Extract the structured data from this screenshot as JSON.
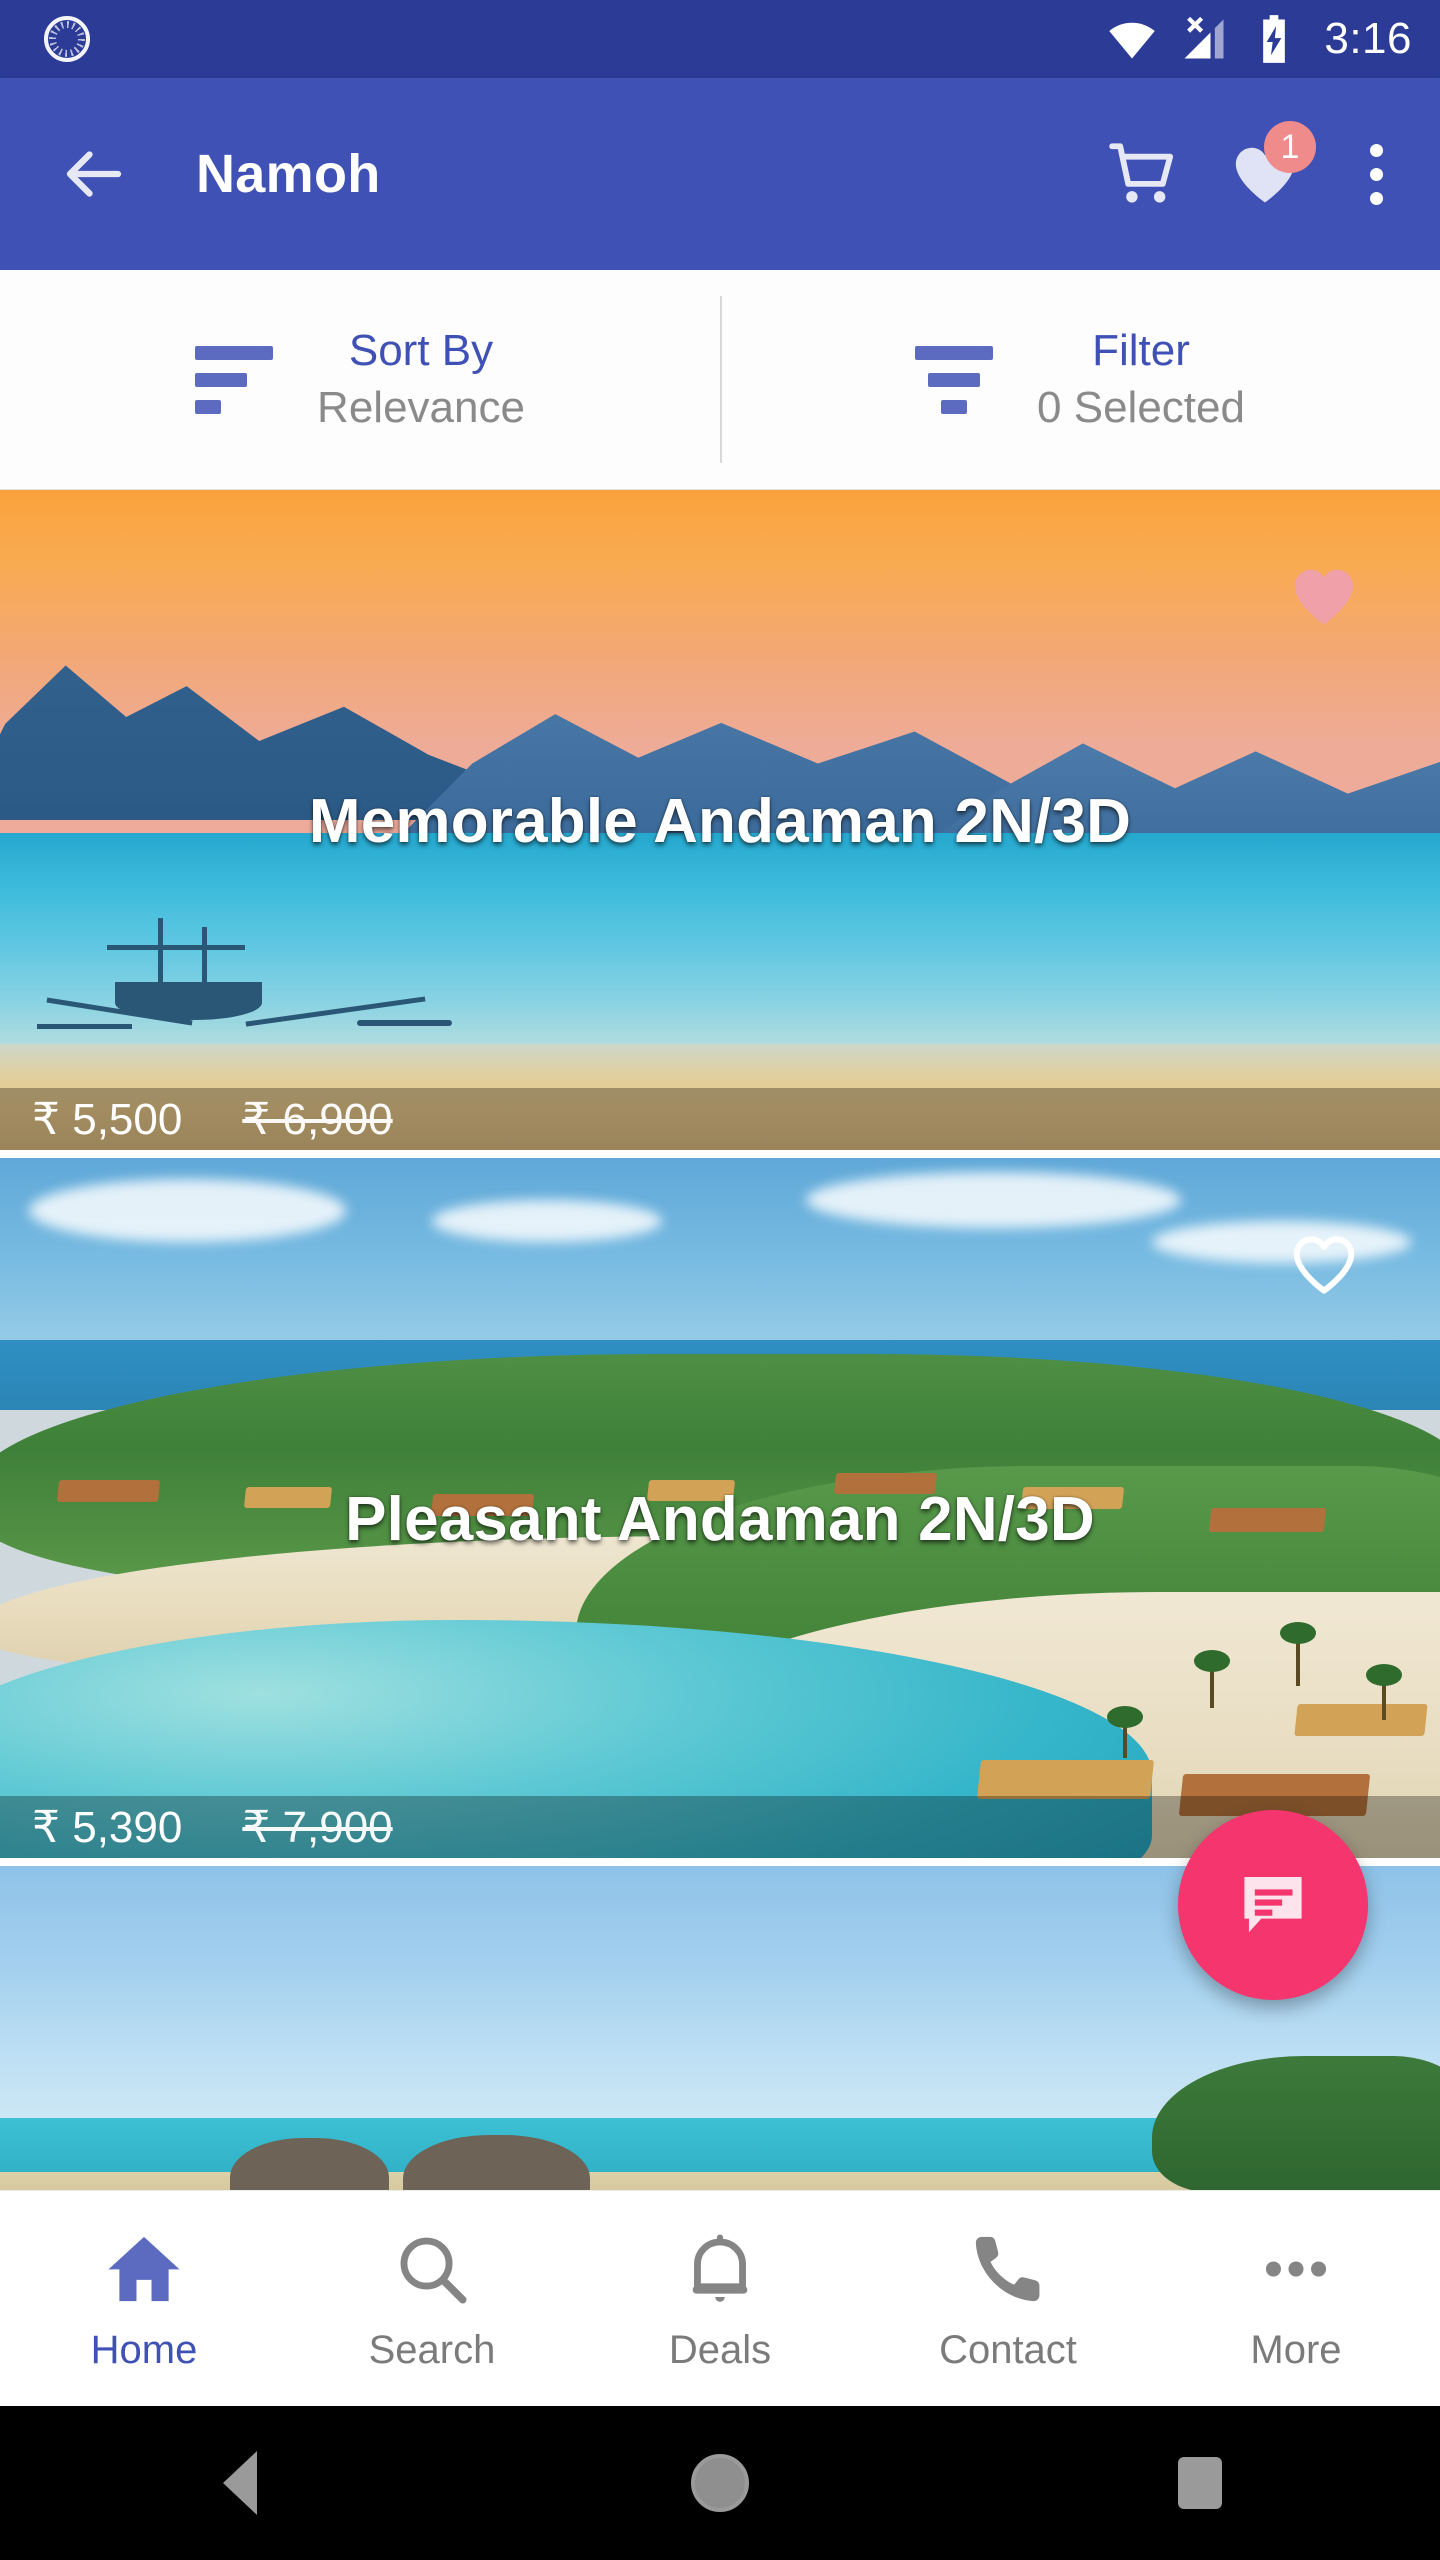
{
  "status_bar": {
    "sync_icon": "sync-progress-icon",
    "wifi_icon": "wifi-icon",
    "signal_icon": "cellular-no-sim-icon",
    "battery_icon": "battery-charging-icon",
    "time": "3:16"
  },
  "app_bar": {
    "back_icon": "back-arrow-icon",
    "title": "Namoh",
    "cart_icon": "shopping-cart-icon",
    "wishlist_icon": "heart-filled-icon",
    "wishlist_badge": "1",
    "overflow_icon": "more-vertical-icon",
    "background": "#3f51b5"
  },
  "sort_filter": {
    "sort": {
      "icon": "sort-bars-icon",
      "title": "Sort By",
      "value": "Relevance"
    },
    "filter": {
      "icon": "filter-funnel-icon",
      "title": "Filter",
      "value": "0 Selected"
    },
    "title_color": "#3f51b5",
    "value_color": "#8a8a8a"
  },
  "packages": [
    {
      "title": "Memorable Andaman 2N/3D",
      "price": "₹ 5,500",
      "original_price": "₹ 6,900",
      "favorite": true,
      "heart_icon": "heart-filled-icon",
      "image_alt": "sunset-bay-outrigger-boat"
    },
    {
      "title": "Pleasant Andaman 2N/3D",
      "price": "₹ 5,390",
      "original_price": "₹ 7,900",
      "favorite": false,
      "heart_icon": "heart-outline-icon",
      "image_alt": "aerial-tropical-resort-bay"
    },
    {
      "title": "",
      "price": "",
      "original_price": "",
      "favorite": false,
      "heart_icon": "heart-outline-icon",
      "image_alt": "beach-with-elephants"
    }
  ],
  "fab": {
    "icon": "chat-bubble-icon",
    "color": "#f5356e"
  },
  "bottom_nav": {
    "active_color": "#3f51b5",
    "inactive_color": "#7b7b7b",
    "items": [
      {
        "label": "Home",
        "icon": "home-icon",
        "active": true
      },
      {
        "label": "Search",
        "icon": "search-icon",
        "active": false
      },
      {
        "label": "Deals",
        "icon": "bell-icon",
        "active": false
      },
      {
        "label": "Contact",
        "icon": "phone-icon",
        "active": false
      },
      {
        "label": "More",
        "icon": "more-horizontal-icon",
        "active": false
      }
    ]
  },
  "system_nav": {
    "back": "system-back-icon",
    "home": "system-home-icon",
    "recents": "system-recents-icon"
  }
}
